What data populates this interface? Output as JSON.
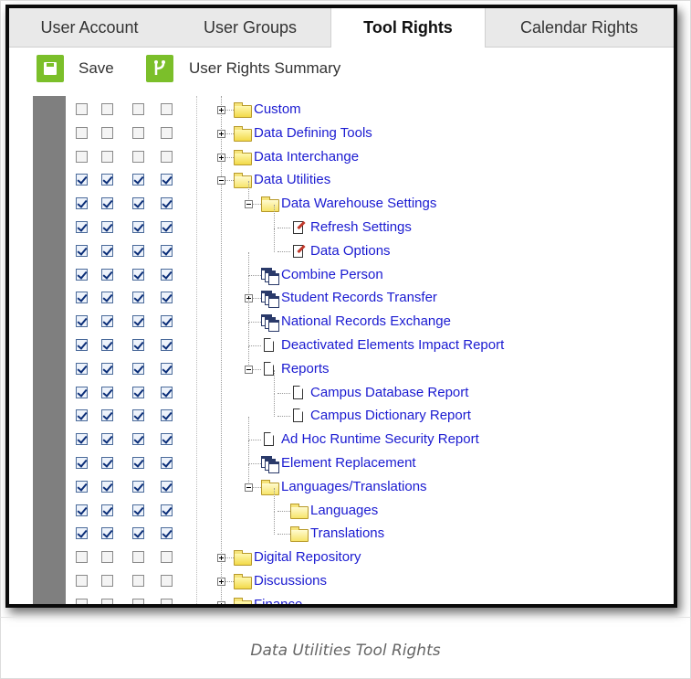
{
  "tabs": [
    {
      "label": "User Account",
      "active": false
    },
    {
      "label": "User Groups",
      "active": false
    },
    {
      "label": "Tool Rights",
      "active": true
    },
    {
      "label": "Calendar Rights",
      "active": false
    }
  ],
  "toolbar": {
    "save_label": "Save",
    "summary_label": "User Rights Summary",
    "icon_color": "#7bbf2a"
  },
  "tree": [
    {
      "label": "Custom",
      "icon": "folder-icon",
      "level": 0,
      "expander": "plus",
      "checks": [
        false,
        false,
        false,
        false
      ]
    },
    {
      "label": "Data Defining Tools",
      "icon": "folder-icon",
      "level": 0,
      "expander": "plus",
      "checks": [
        false,
        false,
        false,
        false
      ]
    },
    {
      "label": "Data Interchange",
      "icon": "folder-icon",
      "level": 0,
      "expander": "plus",
      "checks": [
        false,
        false,
        false,
        false
      ]
    },
    {
      "label": "Data Utilities",
      "icon": "open-folder-icon",
      "level": 0,
      "expander": "minus",
      "checks": [
        true,
        true,
        true,
        true
      ]
    },
    {
      "label": "Data Warehouse Settings",
      "icon": "open-folder-icon",
      "level": 1,
      "expander": "minus",
      "checks": [
        true,
        true,
        true,
        true
      ]
    },
    {
      "label": "Refresh Settings",
      "icon": "edit-icon",
      "level": 2,
      "expander": "",
      "checks": [
        true,
        true,
        true,
        true
      ]
    },
    {
      "label": "Data Options",
      "icon": "edit-icon",
      "level": 2,
      "expander": "",
      "checks": [
        true,
        true,
        true,
        true
      ]
    },
    {
      "label": "Combine Person",
      "icon": "tool-icon",
      "level": 1,
      "expander": "",
      "checks": [
        true,
        true,
        true,
        true
      ]
    },
    {
      "label": "Student Records Transfer",
      "icon": "tool-icon",
      "level": 1,
      "expander": "plus",
      "checks": [
        true,
        true,
        true,
        true
      ]
    },
    {
      "label": "National Records Exchange",
      "icon": "tool-icon",
      "level": 1,
      "expander": "",
      "checks": [
        true,
        true,
        true,
        true
      ]
    },
    {
      "label": "Deactivated Elements Impact Report",
      "icon": "document-icon",
      "level": 1,
      "expander": "",
      "checks": [
        true,
        true,
        true,
        true
      ]
    },
    {
      "label": "Reports",
      "icon": "document-icon",
      "level": 1,
      "expander": "minus",
      "checks": [
        true,
        true,
        true,
        true
      ]
    },
    {
      "label": "Campus Database Report",
      "icon": "document-icon",
      "level": 2,
      "expander": "",
      "checks": [
        true,
        true,
        true,
        true
      ]
    },
    {
      "label": "Campus Dictionary Report",
      "icon": "document-icon",
      "level": 2,
      "expander": "",
      "checks": [
        true,
        true,
        true,
        true
      ]
    },
    {
      "label": "Ad Hoc Runtime Security Report",
      "icon": "document-icon",
      "level": 1,
      "expander": "",
      "checks": [
        true,
        true,
        true,
        true
      ]
    },
    {
      "label": "Element Replacement",
      "icon": "tool-icon",
      "level": 1,
      "expander": "",
      "checks": [
        true,
        true,
        true,
        true
      ]
    },
    {
      "label": "Languages/Translations",
      "icon": "open-folder-icon",
      "level": 1,
      "expander": "minus",
      "checks": [
        true,
        true,
        true,
        true
      ]
    },
    {
      "label": "Languages",
      "icon": "open-folder-icon",
      "level": 2,
      "expander": "",
      "checks": [
        true,
        true,
        true,
        true
      ]
    },
    {
      "label": "Translations",
      "icon": "open-folder-icon",
      "level": 2,
      "expander": "",
      "checks": [
        true,
        true,
        true,
        true
      ]
    },
    {
      "label": "Digital Repository",
      "icon": "folder-icon",
      "level": 0,
      "expander": "plus",
      "checks": [
        false,
        false,
        false,
        false
      ]
    },
    {
      "label": "Discussions",
      "icon": "folder-icon",
      "level": 0,
      "expander": "plus",
      "checks": [
        false,
        false,
        false,
        false
      ]
    },
    {
      "label": "Finance",
      "icon": "folder-icon",
      "level": 0,
      "expander": "plus",
      "checks": [
        false,
        false,
        false,
        false
      ]
    }
  ],
  "caption": "Data Utilities Tool Rights"
}
